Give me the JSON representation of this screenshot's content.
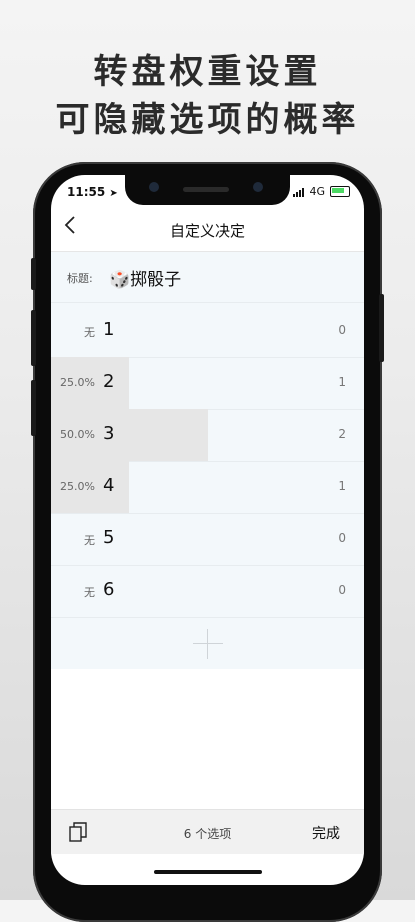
{
  "promo": {
    "line1": "转盘权重设置",
    "line2": "可隐藏选项的概率"
  },
  "status": {
    "time": "11:55",
    "network": "4G"
  },
  "nav": {
    "title": "自定义决定",
    "back_icon": "chevron-left-icon"
  },
  "title_field": {
    "label": "标题:",
    "value": "🎲掷骰子"
  },
  "options": [
    {
      "name": "1",
      "percent": "无",
      "weight": "0",
      "share": 0
    },
    {
      "name": "2",
      "percent": "25.0%",
      "weight": "1",
      "share": 0.25
    },
    {
      "name": "3",
      "percent": "50.0%",
      "weight": "2",
      "share": 0.5
    },
    {
      "name": "4",
      "percent": "25.0%",
      "weight": "1",
      "share": 0.25
    },
    {
      "name": "5",
      "percent": "无",
      "weight": "0",
      "share": 0
    },
    {
      "name": "6",
      "percent": "无",
      "weight": "0",
      "share": 0
    }
  ],
  "bottom": {
    "count": "6 个选项",
    "done": "完成",
    "copy_icon": "copy-icon"
  }
}
